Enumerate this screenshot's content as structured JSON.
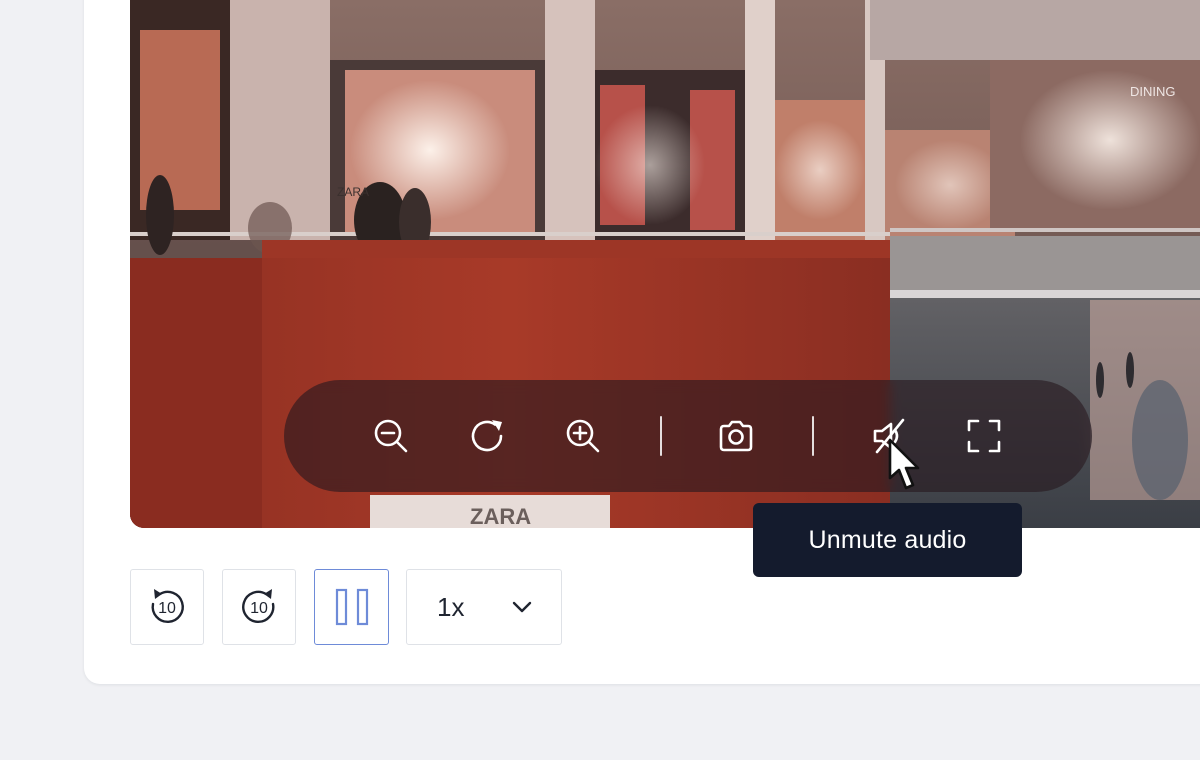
{
  "video": {
    "storefront_signs": [
      "ZARA",
      "ZARA",
      "DINING"
    ]
  },
  "overlay_controls": {
    "zoom_out": {
      "icon": "zoom-out-icon"
    },
    "rotate": {
      "icon": "rotate-icon"
    },
    "zoom_in": {
      "icon": "zoom-in-icon"
    },
    "snapshot": {
      "icon": "camera-icon"
    },
    "mute_toggle": {
      "icon": "speaker-muted-icon"
    },
    "fullscreen": {
      "icon": "fullscreen-icon"
    }
  },
  "tooltip": {
    "text": "Unmute audio"
  },
  "playback": {
    "rewind_label": "10",
    "forward_label": "10",
    "pause": {
      "icon": "pause-icon",
      "active": true
    },
    "speed_value": "1x"
  },
  "colors": {
    "tooltip_bg": "#141b2d",
    "active_border": "#6e8bd8",
    "overlay_bg": "#26181e"
  }
}
